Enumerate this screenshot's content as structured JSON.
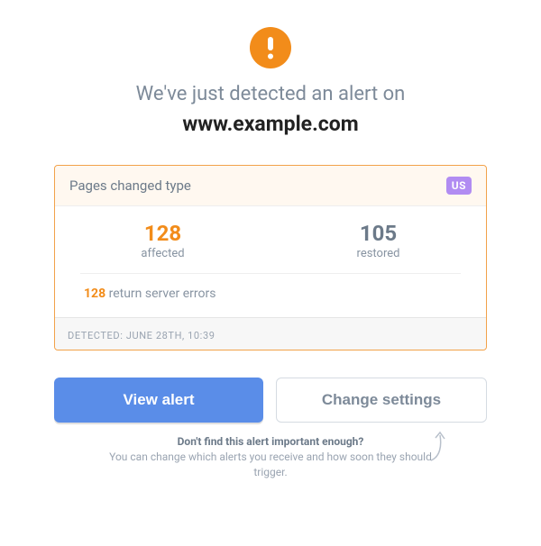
{
  "headline": {
    "prefix": "We've just detected an alert on",
    "site": "www.example.com"
  },
  "card": {
    "title": "Pages changed type",
    "badge": "US",
    "stats": {
      "affected": {
        "value": "128",
        "label": "affected"
      },
      "restored": {
        "value": "105",
        "label": "restored"
      }
    },
    "detail": {
      "count": "128",
      "text": "return server errors"
    },
    "detected": "DETECTED: JUNE 28TH, 10:39"
  },
  "actions": {
    "view": "View alert",
    "settings": "Change settings"
  },
  "hint": {
    "line1": "Don't find this alert important enough?",
    "line2": "You can change which alerts you receive and how soon they should trigger."
  }
}
